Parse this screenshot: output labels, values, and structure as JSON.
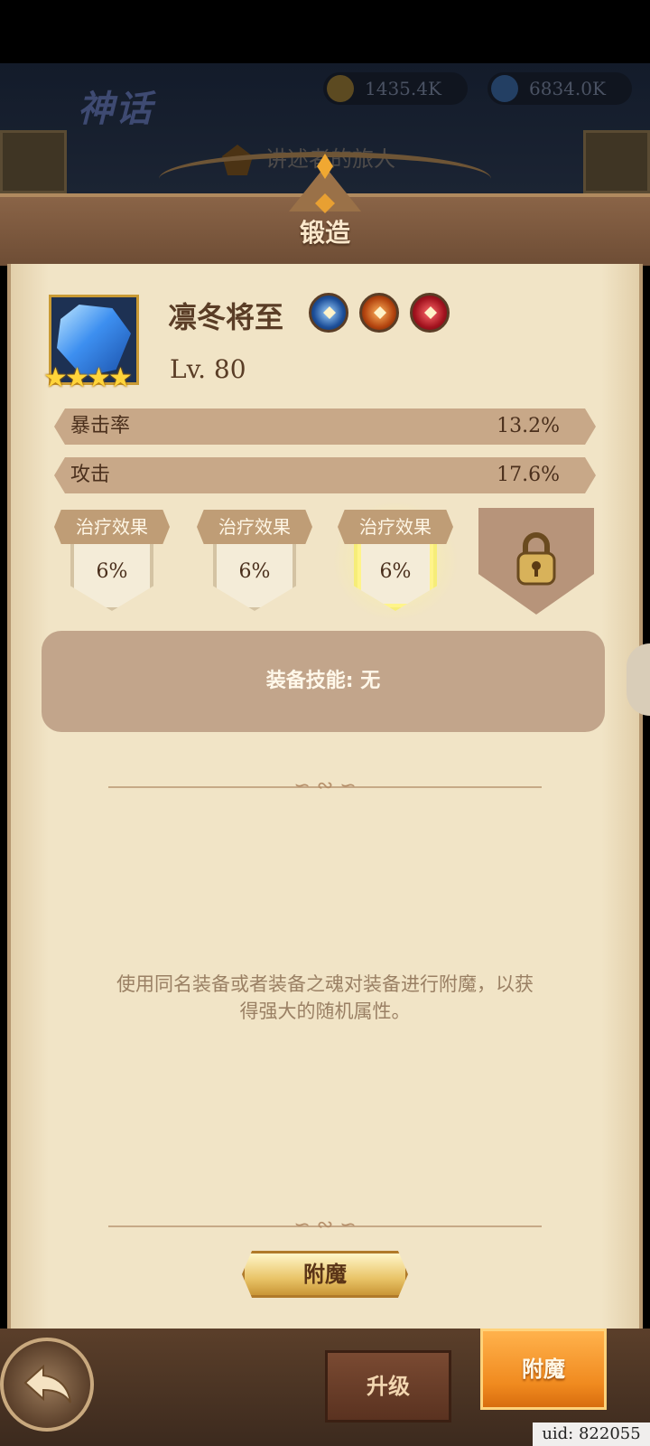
{
  "background": {
    "game_title": "神话",
    "currency_gold": "1435.4K",
    "currency_gem": "6834.0K",
    "quest_text": "讲述者的旅人"
  },
  "panel": {
    "title": "锻造"
  },
  "item": {
    "name": "凛冬将至",
    "level": "Lv. 80",
    "stars": [
      "★",
      "★",
      "★",
      "★"
    ],
    "star_count": 4,
    "badge_icons": [
      "blue-crest-icon",
      "orange-flame-icon",
      "red-shield-icon"
    ]
  },
  "main_stats": [
    {
      "label": "暴击率",
      "value": "13.2%"
    },
    {
      "label": "攻击",
      "value": "17.6%"
    }
  ],
  "sub_stats": [
    {
      "label": "治疗效果",
      "value": "6%"
    },
    {
      "label": "治疗效果",
      "value": "6%"
    },
    {
      "label": "治疗效果",
      "value": "6%"
    }
  ],
  "skill": {
    "text": "装备技能: 无"
  },
  "description": "使用同名装备或者装备之魂对装备进行附魔，以获得强大的随机属性。",
  "buttons": {
    "enchant": "附魔"
  },
  "bottom_tabs": {
    "upgrade": "升级",
    "enchant": "附魔"
  },
  "uid": "uid: 822055",
  "colors": {
    "accent_orange": "#f08a1f",
    "paper": "#f1e4c6",
    "brown_text": "#5a3d26"
  }
}
